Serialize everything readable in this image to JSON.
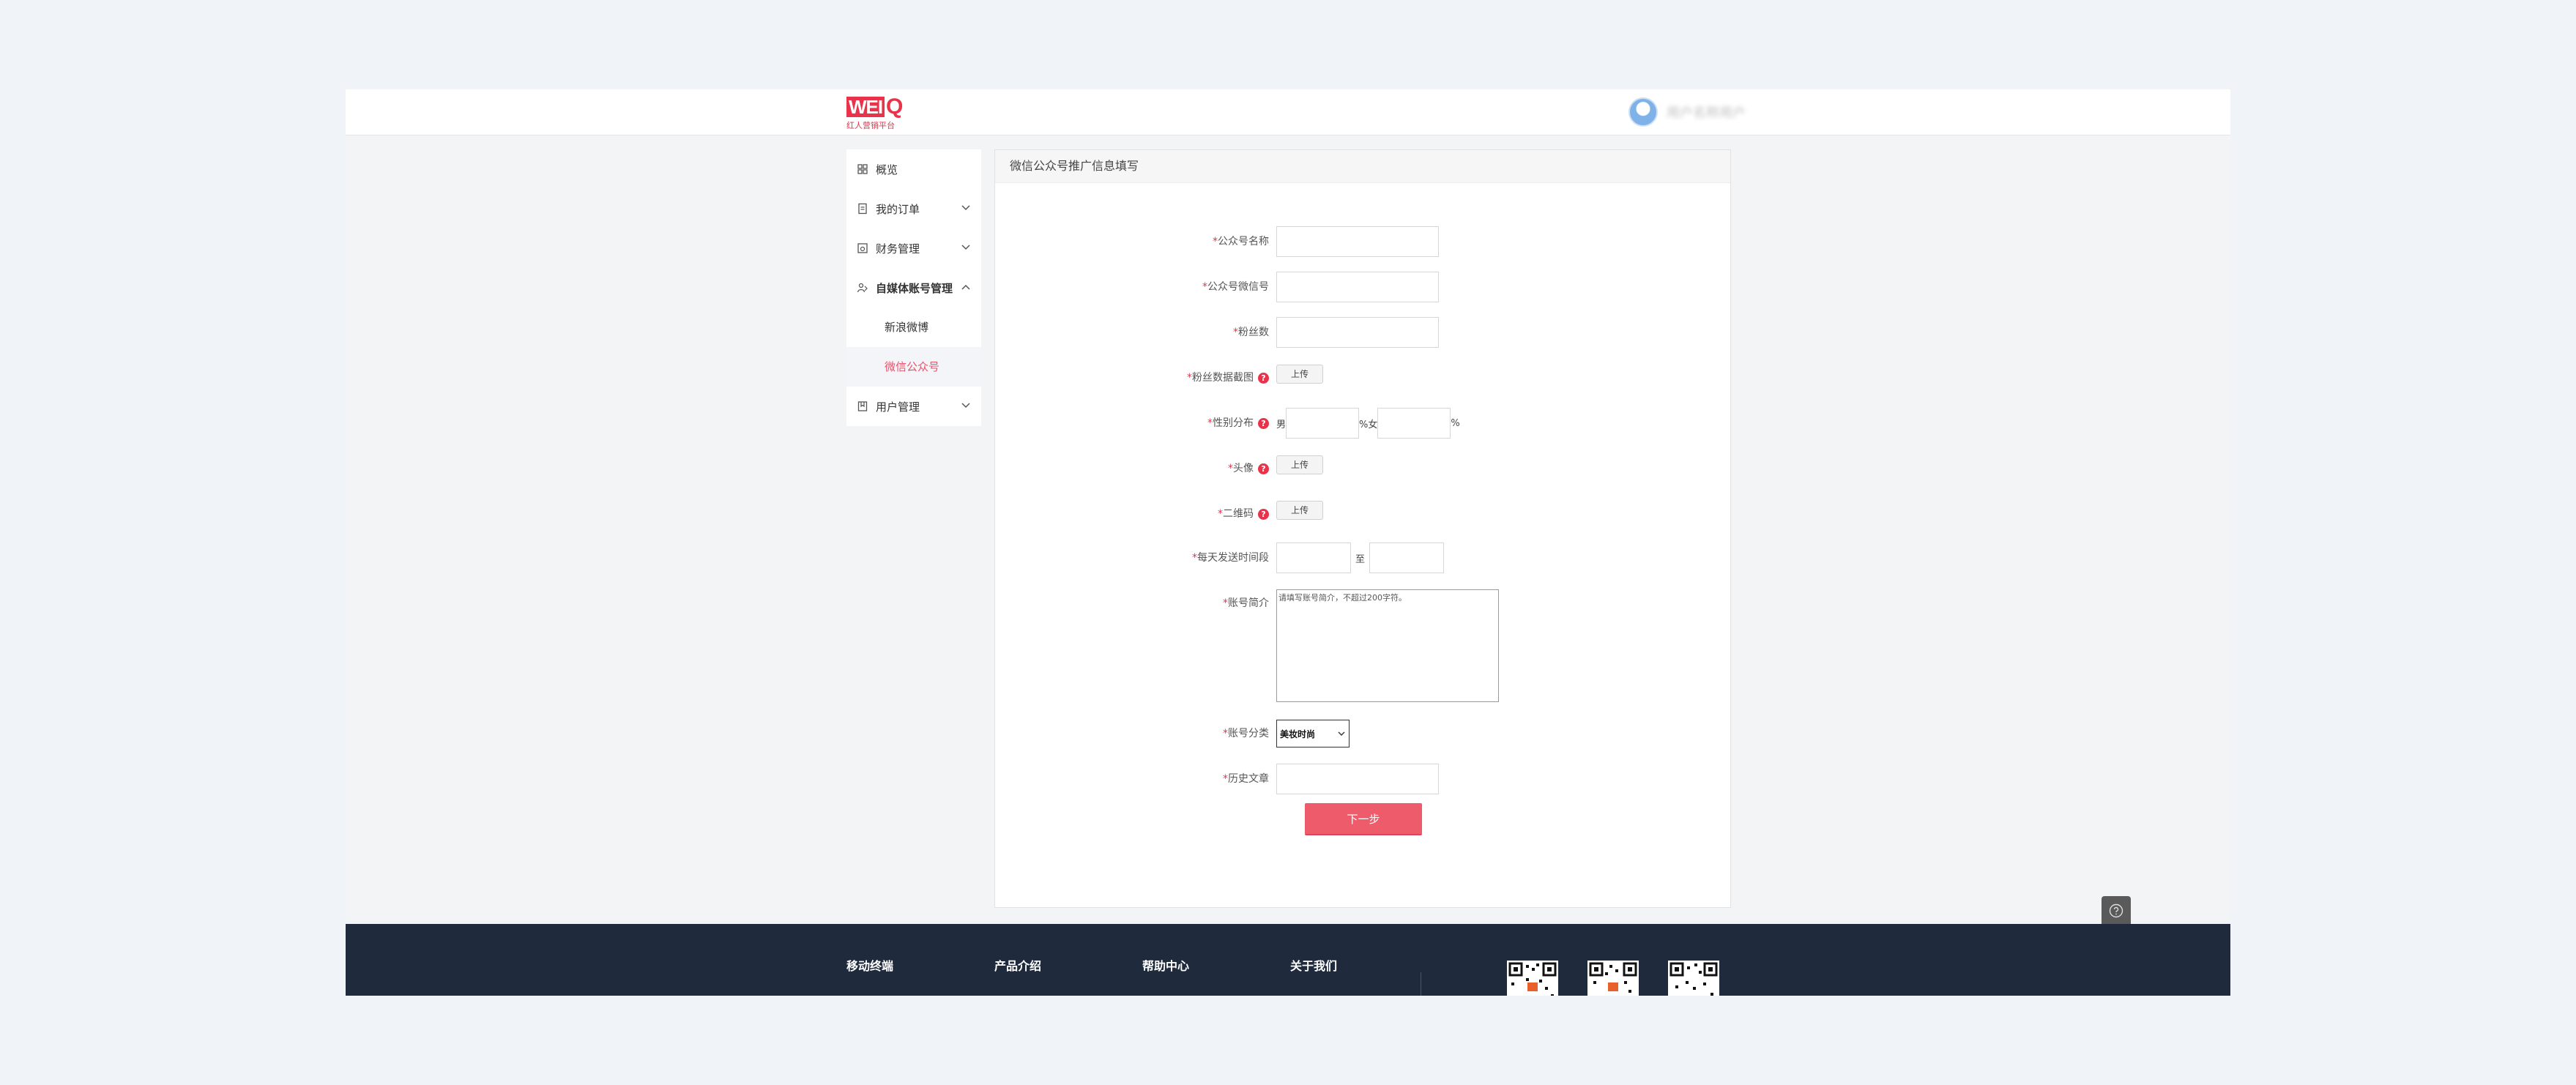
{
  "header": {
    "logo_text": "WEI",
    "logo_q": "Q",
    "logo_tagline": "红人营销平台",
    "username": "用户名称用户"
  },
  "sidebar": {
    "items": [
      {
        "label": "概览",
        "icon": "grid-icon"
      },
      {
        "label": "我的订单",
        "icon": "document-icon"
      },
      {
        "label": "财务管理",
        "icon": "wallet-icon"
      },
      {
        "label": "自媒体账号管理",
        "icon": "user-group-icon"
      },
      {
        "label": "用户管理",
        "icon": "bookmark-icon"
      }
    ],
    "sub_items": [
      {
        "label": "新浪微博"
      },
      {
        "label": "微信公众号"
      }
    ]
  },
  "panel": {
    "title": "微信公众号推广信息填写"
  },
  "form": {
    "required_mark": "*",
    "help_mark": "?",
    "name_label": "公众号名称",
    "wechat_id_label": "公众号微信号",
    "fans_label": "粉丝数",
    "fans_screenshot_label": "粉丝数据截图",
    "gender_label": "性别分布",
    "male_prefix": "男",
    "female_mid": "%女",
    "pct_suffix": "%",
    "avatar_label": "头像",
    "qrcode_label": "二维码",
    "time_label": "每天发送时间段",
    "time_to": "至",
    "intro_label": "账号简介",
    "intro_placeholder": "请填写账号简介，不超过200字符。",
    "category_label": "账号分类",
    "category_selected": "美妆时尚",
    "history_label": "历史文章",
    "upload_label": "上传",
    "next_label": "下一步"
  },
  "footer": {
    "columns": [
      "移动终端",
      "产品介绍",
      "帮助中心",
      "关于我们"
    ]
  },
  "colors": {
    "accent": "#e8334a",
    "button": "#ee5b6a",
    "footer_bg": "#1f2a3d"
  }
}
